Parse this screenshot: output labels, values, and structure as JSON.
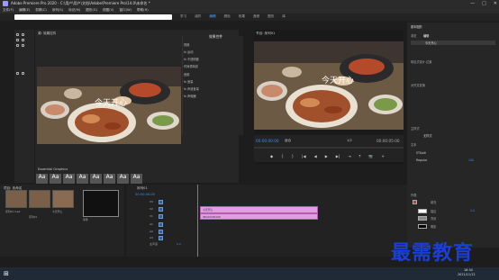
{
  "window": {
    "title": "Adobe Premiere Pro 2020 - C:\\用户\\用户\\文档\\Adobe\\Premiere Pro\\14.0\\未命名 *",
    "controls": [
      "—",
      "□",
      "✕"
    ]
  },
  "menu": [
    "文件(F)",
    "编辑(E)",
    "剪辑(C)",
    "序列(S)",
    "标记(M)",
    "图形(G)",
    "视图(V)",
    "窗口(W)",
    "帮助(H)"
  ],
  "workspace_tabs": {
    "items": [
      "学习",
      "组件",
      "编辑",
      "颜色",
      "效果",
      "音频",
      "图形",
      "库"
    ],
    "active": "编辑"
  },
  "source_panel": {
    "tab": "源: 效果控件",
    "effects_title": "效果控件",
    "effect_rows": [
      "视频",
      "fx 运动",
      "fx 不透明度",
      "时间重映射",
      "音频",
      "fx 音量",
      "fx 声道音量",
      "fx 声像器"
    ],
    "overlay_text": "今天开心",
    "bottom_tab": "Essential Graphics",
    "text_styles": [
      "Aa",
      "Aa",
      "Aa",
      "Aa",
      "Aa",
      "Aa",
      "Aa",
      "Aa"
    ]
  },
  "program_monitor": {
    "tab": "节目: 序列01",
    "sequence_name": "序列01",
    "overlay_text": "今天开心",
    "timecode_current": "00:00:00:00",
    "fit": "适合",
    "quality": "1/2",
    "timecode_duration": "00:00:05:00",
    "controls": [
      "◆",
      "{",
      "}",
      "|◀",
      "◀",
      "▶",
      "▶|",
      "⇥",
      "⤒",
      "📷",
      "+"
    ]
  },
  "right_panel": {
    "tab": "基本图形",
    "subtabs": [
      "浏览",
      "编辑"
    ],
    "active_subtab": "编辑",
    "layer_label": "今天开心",
    "sections": [
      "响应式设计-位置",
      "对齐并变换",
      "主样式",
      "文本",
      "外观"
    ],
    "style_value": "无样式",
    "font": "STKaiti",
    "font_style": "Regular",
    "font_size": "100",
    "appearance": [
      {
        "name": "填充",
        "color": "#c4393c",
        "checked": true
      },
      {
        "name": "描边",
        "color": "#ffffff",
        "checked": false
      },
      {
        "name": "背景",
        "color": "#888888",
        "checked": true
      },
      {
        "name": "阴影",
        "color": "#000000",
        "checked": false
      }
    ],
    "stroke_value": "1.0"
  },
  "project_panel": {
    "tab": "项目: 未命名",
    "thumbs": [
      {
        "label": "序列01.mp4",
        "duration": "5:00"
      },
      {
        "label": "序列01",
        "duration": "5:00"
      },
      {
        "label": "今天开心",
        "duration": "5:00"
      },
      {
        "label": "黑场",
        "duration": "5:00"
      }
    ]
  },
  "timeline": {
    "tab": "序列01",
    "timecode": "00:00:00:00",
    "tracks": [
      "V3",
      "V2",
      "V1",
      "A1",
      "A2",
      "A3",
      "主声道"
    ],
    "clips": [
      {
        "track": "V2",
        "label": "今天开心"
      },
      {
        "track": "V1",
        "label": "IMG20200109"
      }
    ],
    "master_value": "0.0"
  },
  "taskbar": {
    "time": "18:34",
    "date": "2021/11/12"
  },
  "watermark": "最需教育",
  "colors": {
    "accent": "#3a8ee6",
    "clip": "#e39ee2",
    "panel_bg": "#232323",
    "watermark": "#1a3fd6"
  }
}
